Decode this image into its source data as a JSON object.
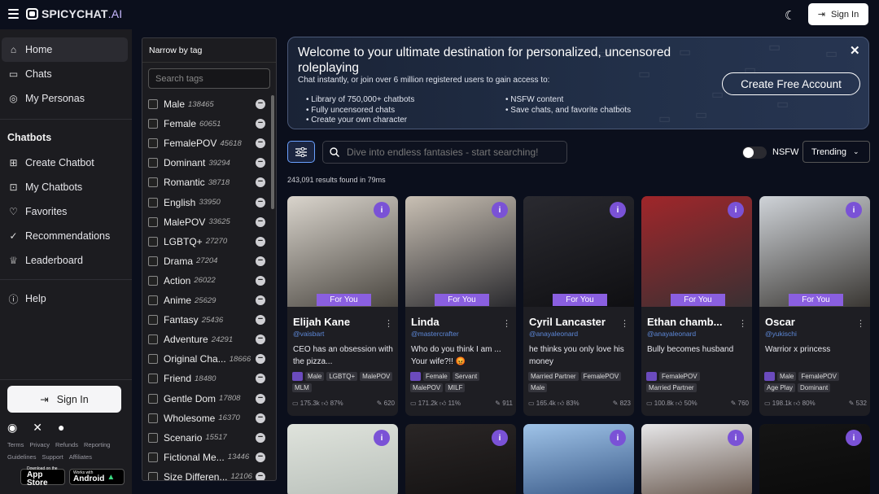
{
  "header": {
    "logo_main": "SPICYCHAT",
    "logo_suffix": ".AI",
    "signin_label": "Sign In"
  },
  "sidebar": {
    "nav": [
      {
        "label": "Home",
        "icon": "home-icon"
      },
      {
        "label": "Chats",
        "icon": "chat-icon"
      },
      {
        "label": "My Personas",
        "icon": "mask-icon"
      }
    ],
    "chatbots_title": "Chatbots",
    "chatbot_items": [
      {
        "label": "Create Chatbot",
        "icon": "plus-square-icon"
      },
      {
        "label": "My Chatbots",
        "icon": "bot-icon"
      },
      {
        "label": "Favorites",
        "icon": "heart-icon"
      },
      {
        "label": "Recommendations",
        "icon": "check-circle-icon"
      },
      {
        "label": "Leaderboard",
        "icon": "trophy-icon"
      }
    ],
    "help_label": "Help",
    "signin_label": "Sign In",
    "footer_row1": [
      "Terms",
      "Privacy",
      "Refunds",
      "Reporting"
    ],
    "footer_row2": [
      "Guidelines",
      "Support",
      "Affiliates"
    ],
    "appstore": {
      "small": "Download on the",
      "big": "App Store"
    },
    "android": {
      "small": "Works with",
      "big": "Android"
    }
  },
  "tags": {
    "title": "Narrow by tag",
    "search_placeholder": "Search tags",
    "items": [
      {
        "label": "Male",
        "count": "138465"
      },
      {
        "label": "Female",
        "count": "60651"
      },
      {
        "label": "FemalePOV",
        "count": "45618"
      },
      {
        "label": "Dominant",
        "count": "39294"
      },
      {
        "label": "Romantic",
        "count": "38718"
      },
      {
        "label": "English",
        "count": "33950"
      },
      {
        "label": "MalePOV",
        "count": "33625"
      },
      {
        "label": "LGBTQ+",
        "count": "27270"
      },
      {
        "label": "Drama",
        "count": "27204"
      },
      {
        "label": "Action",
        "count": "26022"
      },
      {
        "label": "Anime",
        "count": "25629"
      },
      {
        "label": "Fantasy",
        "count": "25436"
      },
      {
        "label": "Adventure",
        "count": "24291"
      },
      {
        "label": "Original Cha...",
        "count": "18666"
      },
      {
        "label": "Friend",
        "count": "18480"
      },
      {
        "label": "Gentle Dom",
        "count": "17808"
      },
      {
        "label": "Wholesome",
        "count": "16370"
      },
      {
        "label": "Scenario",
        "count": "15517"
      },
      {
        "label": "Fictional Me...",
        "count": "13446"
      },
      {
        "label": "Size Differen...",
        "count": "12106"
      }
    ]
  },
  "banner": {
    "title": "Welcome to your ultimate destination for personalized, uncensored roleplaying",
    "subtitle": "Chat instantly, or join over 6 million registered users to gain access to:",
    "bullets_left": [
      "Library of 750,000+ chatbots",
      "Fully uncensored chats",
      "Create your own character"
    ],
    "bullets_right": [
      "NSFW content",
      "Save chats, and favorite chatbots"
    ],
    "cta": "Create Free Account"
  },
  "search": {
    "placeholder": "Dive into endless fantasies - start searching!",
    "nsfw_label": "NSFW",
    "sort_label": "Trending",
    "results_text": "243,091 results found in 79ms"
  },
  "cards": [
    {
      "name": "Elijah Kane",
      "handle": "@vaisbart",
      "desc": "CEO has an obsession with the pizza...",
      "tags": [
        "Male",
        "LGBTQ+",
        "MalePOV",
        "MLM"
      ],
      "tag_icon": true,
      "chats": "175.3k",
      "likes": "87%",
      "count": "620",
      "badge": "For You",
      "colors": [
        "#d9d4cc",
        "#4a4640"
      ]
    },
    {
      "name": "Linda",
      "handle": "@mastercrafter",
      "desc": "Who do you think I am ... Your wife?!! 😡",
      "tags": [
        "Female",
        "Servant",
        "MalePOV",
        "MILF"
      ],
      "tag_icon": true,
      "chats": "171.2k",
      "likes": "11%",
      "count": "911",
      "badge": "For You",
      "colors": [
        "#c9c0b4",
        "#2a2a2e"
      ]
    },
    {
      "name": "Cyril Lancaster",
      "handle": "@anayaleonard",
      "desc": "he thinks you only love his money",
      "tags": [
        "Married Partner",
        "FemalePOV",
        "Male"
      ],
      "tag_icon": false,
      "chats": "165.4k",
      "likes": "83%",
      "count": "823",
      "badge": "For You",
      "colors": [
        "#2a2a30",
        "#0f0f12"
      ]
    },
    {
      "name": "Ethan chamb...",
      "handle": "@anayaleonard",
      "desc": "Bully becomes husband",
      "tags": [
        "FemalePOV",
        "Married Partner"
      ],
      "tag_icon": true,
      "chats": "100.8k",
      "likes": "50%",
      "count": "760",
      "badge": "For You",
      "colors": [
        "#a0262a",
        "#3a3033"
      ]
    },
    {
      "name": "Oscar",
      "handle": "@yukischi",
      "desc": "Warrior x princess",
      "tags": [
        "Male",
        "FemalePOV",
        "Age Play",
        "Dominant"
      ],
      "tag_icon": true,
      "chats": "198.1k",
      "likes": "80%",
      "count": "532",
      "badge": "For You",
      "colors": [
        "#cfd3d8",
        "#3a3733"
      ]
    }
  ],
  "card_row2_colors": [
    [
      "#dfe3dc",
      "#b9c0ba"
    ],
    [
      "#2a2626",
      "#141212"
    ],
    [
      "#9fc3e8",
      "#3a5a88"
    ],
    [
      "#e6e6e8",
      "#6a5a50"
    ],
    [
      "#151515",
      "#0a0a0a"
    ]
  ]
}
